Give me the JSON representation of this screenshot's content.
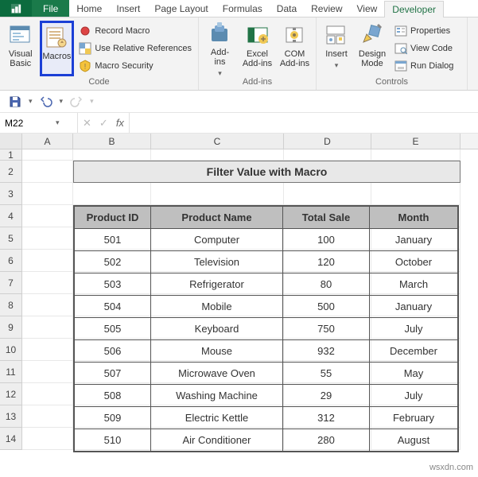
{
  "tabs": {
    "file": "File",
    "items": [
      "Home",
      "Insert",
      "Page Layout",
      "Formulas",
      "Data",
      "Review",
      "View",
      "Developer"
    ],
    "active": "Developer"
  },
  "ribbon": {
    "code": {
      "label": "Code",
      "visual_basic": "Visual\nBasic",
      "macros": "Macros",
      "record_macro": "Record Macro",
      "use_relative": "Use Relative References",
      "macro_security": "Macro Security"
    },
    "addins": {
      "label": "Add-ins",
      "addins": "Add-\nins",
      "excel_addins": "Excel\nAdd-ins",
      "com_addins": "COM\nAdd-ins"
    },
    "controls": {
      "label": "Controls",
      "insert": "Insert",
      "design_mode": "Design\nMode",
      "properties": "Properties",
      "view_code": "View Code",
      "run_dialog": "Run Dialog"
    }
  },
  "namebox": {
    "value": "M22"
  },
  "formula": {
    "value": ""
  },
  "columns": [
    "A",
    "B",
    "C",
    "D",
    "E"
  ],
  "rows": [
    "1",
    "2",
    "3",
    "4",
    "5",
    "6",
    "7",
    "8",
    "9",
    "10",
    "11",
    "12",
    "13",
    "14"
  ],
  "sheet_title": "Filter Value with Macro",
  "table": {
    "headers": [
      "Product ID",
      "Product Name",
      "Total Sale",
      "Month"
    ],
    "rows": [
      [
        "501",
        "Computer",
        "100",
        "January"
      ],
      [
        "502",
        "Television",
        "120",
        "October"
      ],
      [
        "503",
        "Refrigerator",
        "80",
        "March"
      ],
      [
        "504",
        "Mobile",
        "500",
        "January"
      ],
      [
        "505",
        "Keyboard",
        "750",
        "July"
      ],
      [
        "506",
        "Mouse",
        "932",
        "December"
      ],
      [
        "507",
        "Microwave Oven",
        "55",
        "May"
      ],
      [
        "508",
        "Washing Machine",
        "29",
        "July"
      ],
      [
        "509",
        "Electric Kettle",
        "312",
        "February"
      ],
      [
        "510",
        "Air Conditioner",
        "280",
        "August"
      ]
    ]
  },
  "watermark": "wsxdn.com"
}
